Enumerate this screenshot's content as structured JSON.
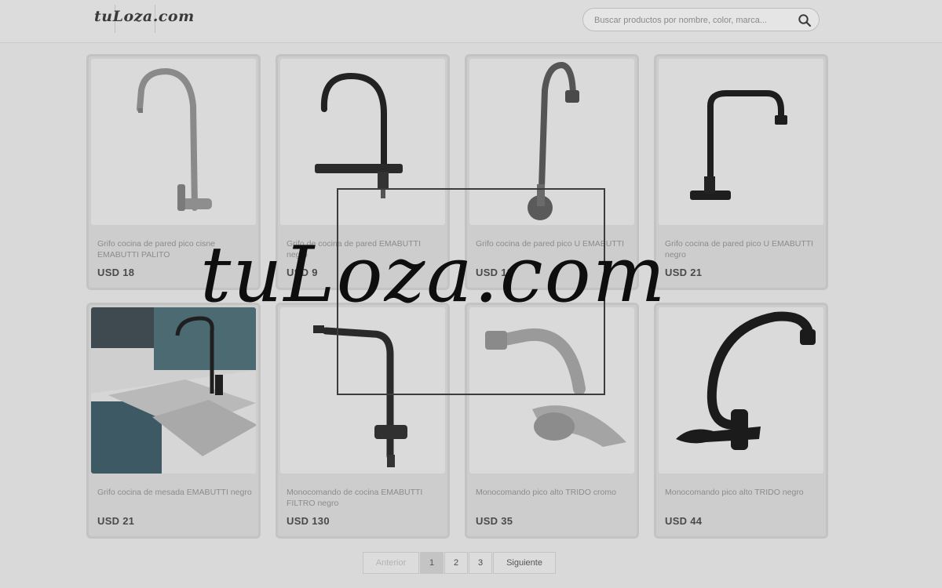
{
  "header": {
    "logo": "tuLoza.com",
    "search_placeholder": "Buscar productos por nombre, color, marca..."
  },
  "products": [
    {
      "name": "Grifo cocina de pared pico cisne EMABUTTI PALITO",
      "price": "USD 18",
      "image": "swan-neck faucet chrome"
    },
    {
      "name": "Grifo de cocina de pared EMABUTTI negro",
      "price": "USD 9",
      "image": "wall faucet black"
    },
    {
      "name": "Grifo cocina de pared pico U EMABUTTI",
      "price": "USD 18",
      "image": "tall U spout faucet"
    },
    {
      "name": "Grifo cocina de pared pico U EMABUTTI negro",
      "price": "USD 21",
      "image": "wall faucet black squared"
    },
    {
      "name": "Grifo cocina de mesada EMABUTTI negro",
      "price": "USD 21",
      "image": "black faucet on sink"
    },
    {
      "name": "Monocomando de cocina EMABUTTI FILTRO negro",
      "price": "USD 130",
      "image": "filter mixer black"
    },
    {
      "name": "Monocomando pico alto TRIDO cromo",
      "price": "USD 35",
      "image": "chrome mixer"
    },
    {
      "name": "Monocomando pico alto TRIDO negro",
      "price": "USD 44",
      "image": "black curved wall faucet"
    }
  ],
  "pagination": {
    "prev": "Anterior",
    "pages": [
      "1",
      "2",
      "3"
    ],
    "active": "1",
    "next": "Siguiente"
  },
  "watermark": "tuLoza.com"
}
